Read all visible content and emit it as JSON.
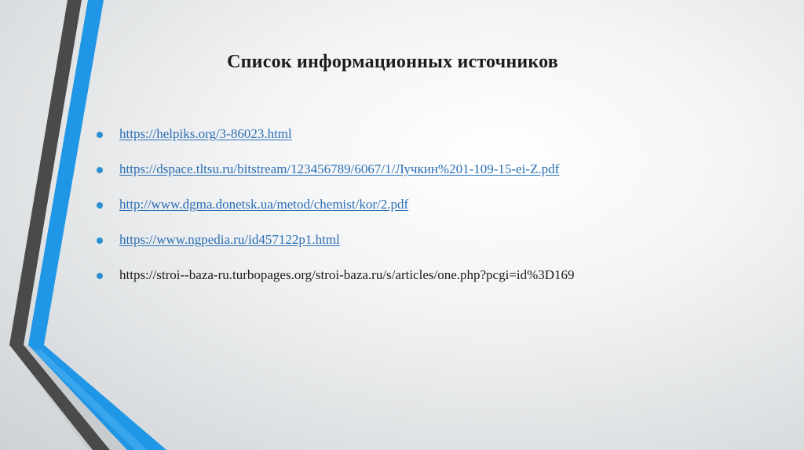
{
  "slide": {
    "title": "Список информационных источников",
    "accent_color": "#2b8fd2",
    "stripe_dark_color": "#4a4a4a",
    "stripe_blue_color": "#1f96e6",
    "sources": [
      {
        "text": "https://helpiks.org/3-86023.html",
        "is_link": true
      },
      {
        "text": "https://dspace.tltsu.ru/bitstream/123456789/6067/1/Лучкин%201-109-15-ei-Z.pdf",
        "is_link": true
      },
      {
        "text": "http://www.dgma.donetsk.ua/metod/chemist/kor/2.pdf",
        "is_link": true
      },
      {
        "text": "https://www.ngpedia.ru/id457122p1.html",
        "is_link": true
      },
      {
        "text": "https://stroi--baza-ru.turbopages.org/stroi-baza.ru/s/articles/one.php?pcgi=id%3D169",
        "is_link": false
      }
    ]
  }
}
